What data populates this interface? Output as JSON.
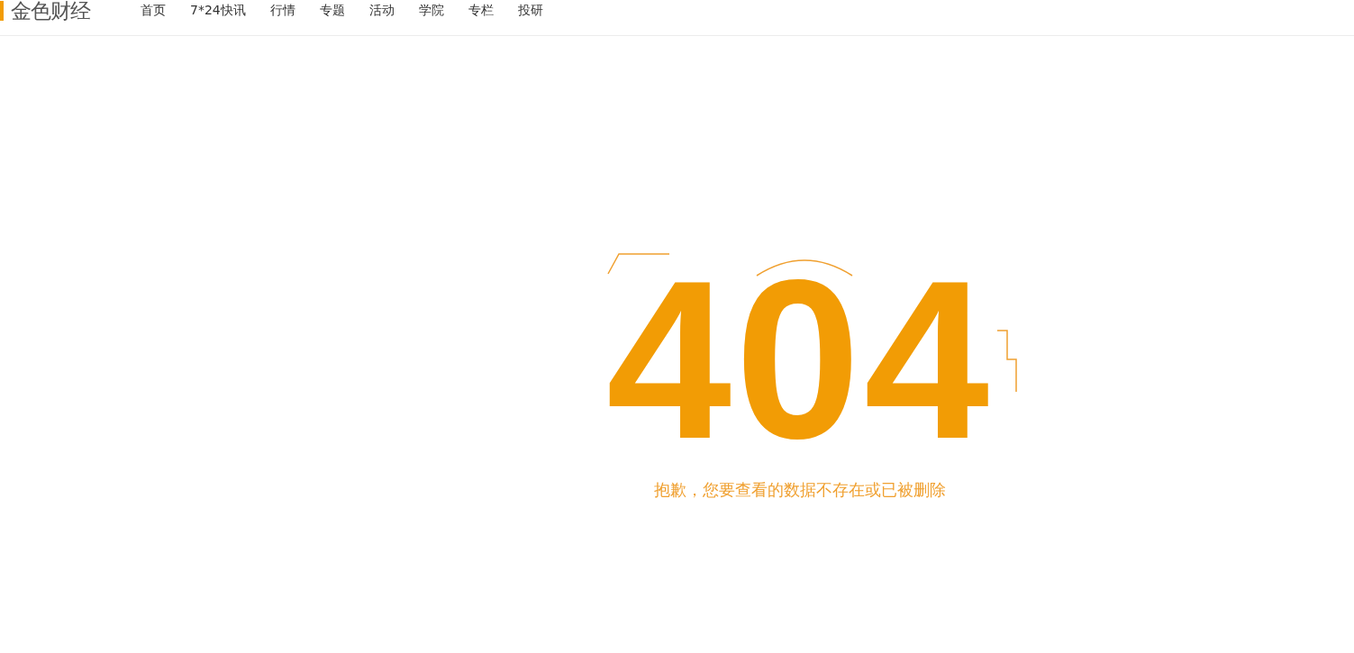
{
  "header": {
    "logo": "金色财经",
    "nav": [
      {
        "label": "首页"
      },
      {
        "label": "7*24快讯"
      },
      {
        "label": "行情"
      },
      {
        "label": "专题"
      },
      {
        "label": "活动"
      },
      {
        "label": "学院"
      },
      {
        "label": "专栏"
      },
      {
        "label": "投研"
      }
    ]
  },
  "error": {
    "code": "404",
    "message": "抱歉，您要查看的数据不存在或已被删除"
  }
}
